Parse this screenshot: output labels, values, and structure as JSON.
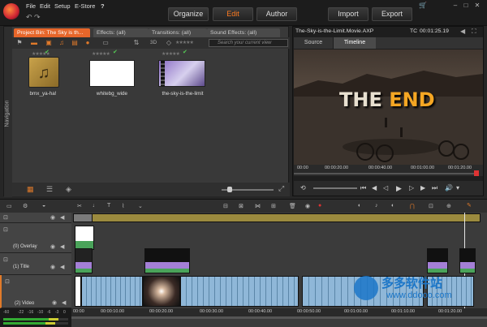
{
  "menu": {
    "items": [
      "File",
      "Edit",
      "Setup",
      "E-Store",
      "?"
    ]
  },
  "main_tabs": {
    "organize": "Organize",
    "edit": "Edit",
    "author": "Author",
    "import": "Import",
    "export": "Export"
  },
  "library": {
    "navigation_label": "Navigation",
    "tabs": [
      "Project Bin: The Sky is th...",
      "Effects: (all)",
      "Transitions: (all)",
      "Sound Effects: (all)"
    ],
    "view_3d": "3D",
    "search_placeholder": "Search your current view",
    "items": [
      {
        "caption": "bmx_ya-ha!",
        "checked": true
      },
      {
        "caption": "whitebg_wide",
        "checked": true
      },
      {
        "caption": "the-sky-is-the-limit",
        "checked": true
      }
    ]
  },
  "preview": {
    "title": "The-Sky-is-the-Limit.Movie.AXP",
    "timecode_label": "TC",
    "timecode": "00:01:25.19",
    "tabs": [
      "Source",
      "Timeline"
    ],
    "active_tab": "Timeline",
    "title_text_white": "THE ",
    "title_text_orange": "END",
    "ruler": [
      "00:00",
      "00:00:20.00",
      "00:00:40.00",
      "00:01:00.00",
      "00:01:20.00"
    ]
  },
  "timeline": {
    "tracks": [
      {
        "name": ""
      },
      {
        "name": "(0) Overlay"
      },
      {
        "name": "(1) Title"
      },
      {
        "name": "(2) Video"
      }
    ],
    "ruler": [
      "00:00",
      "00:00:10.00",
      "00:00:20.00",
      "00:00:30.00",
      "00:00:40.00",
      "00:00:50.00",
      "00:01:00.00",
      "00:01:10.00",
      "00:01:20.00"
    ],
    "meter_labels": [
      "-60",
      "-22",
      "-16",
      "-10",
      "-6",
      "-3",
      "0"
    ]
  },
  "watermark": {
    "brand": "多多软件站",
    "url": "www.ddooo.com"
  }
}
